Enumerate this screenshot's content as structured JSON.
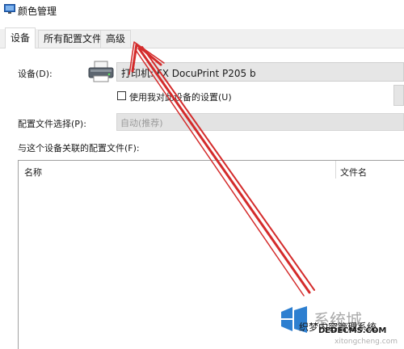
{
  "window": {
    "title": "颜色管理",
    "icon": "color-management-icon"
  },
  "tabs": [
    {
      "label": "设备",
      "active": true
    },
    {
      "label": "所有配置文件",
      "active": false
    },
    {
      "label": "高级",
      "active": false
    }
  ],
  "device": {
    "label": "设备(D):",
    "selected": "打印机: FX DocuPrint P205 b",
    "icon": "printer-icon",
    "use_settings_label": "使用我对此设备的设置(U)",
    "use_settings_checked": false
  },
  "profile_selection": {
    "label": "配置文件选择(P):",
    "value": "自动(推荐)"
  },
  "associated_profiles": {
    "label": "与这个设备关联的配置文件(F):",
    "columns": [
      "名称",
      "文件名"
    ]
  },
  "watermark": {
    "brand": "系统城",
    "domain1": "DEDECMS.COM",
    "site_text": "织梦内容管理系统",
    "domain2": "xitongcheng.com",
    "icon": "windows-logo-icon"
  },
  "annotation": {
    "color": "#d42b2b",
    "icon": "red-arrow-annotation"
  }
}
